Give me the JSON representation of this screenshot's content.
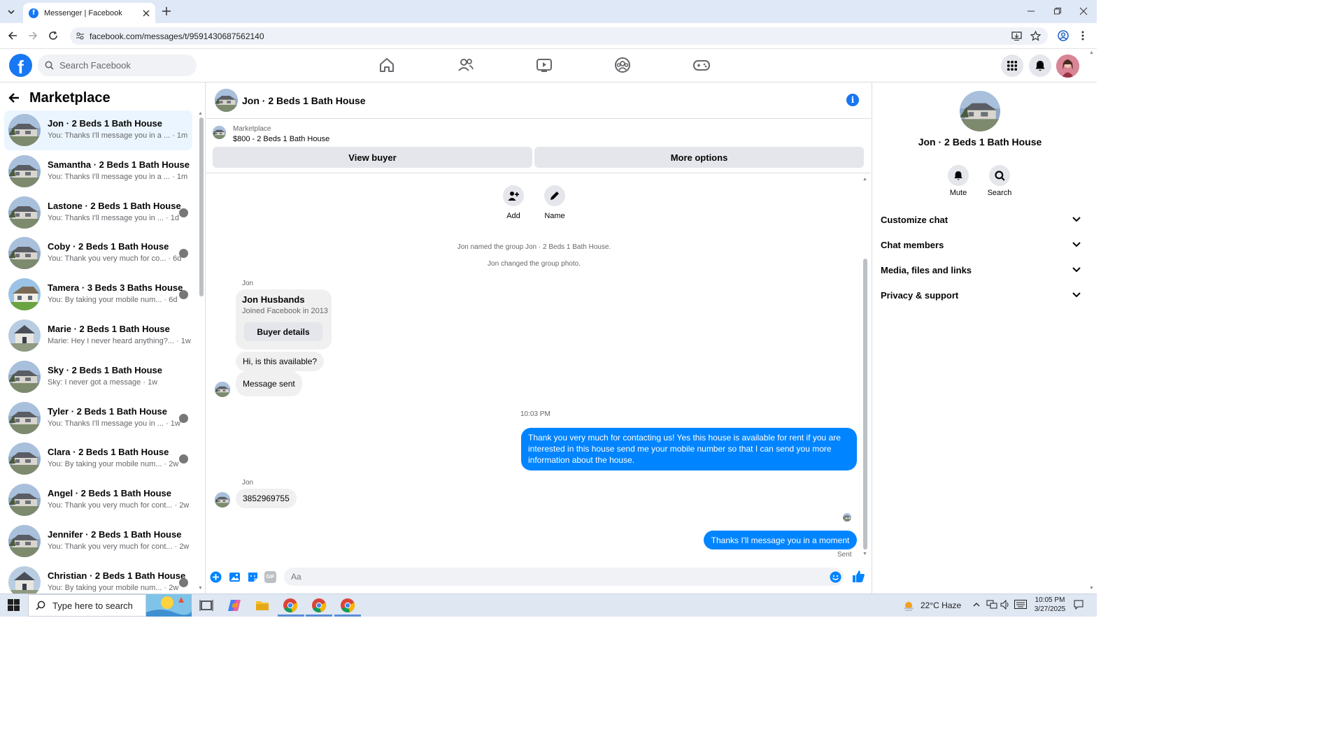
{
  "browser": {
    "tab_title": "Messenger | Facebook",
    "url": "facebook.com/messages/t/9591430687562140"
  },
  "fb": {
    "search_placeholder": "Search Facebook"
  },
  "sidebar": {
    "title": "Marketplace",
    "conversations": [
      {
        "name": "Jon · 2 Beds 1 Bath House",
        "preview": "You: Thanks I'll message you in a ... · 1m",
        "active": true
      },
      {
        "name": "Samantha · 2 Beds 1 Bath House",
        "preview": "You: Thanks I'll message you in a ... · 1m"
      },
      {
        "name": "Lastone · 2 Beds 1 Bath House",
        "preview": "You: Thanks I'll message you in ... · 1d"
      },
      {
        "name": "Coby · 2 Beds 1 Bath House",
        "preview": "You: Thank you very much for co... · 6d"
      },
      {
        "name": "Tamera · 3 Beds 3 Baths House",
        "preview": "You: By taking your mobile num... · 6d"
      },
      {
        "name": "Marie · 2 Beds 1 Bath House",
        "preview": "Marie: Hey I never heard anything?... · 1w"
      },
      {
        "name": "Sky · 2 Beds 1 Bath House",
        "preview": "Sky: I never got a message · 1w"
      },
      {
        "name": "Tyler · 2 Beds 1 Bath House",
        "preview": "You: Thanks I'll message you in ... · 1w"
      },
      {
        "name": "Clara · 2 Beds 1 Bath House",
        "preview": "You: By taking your mobile num... · 2w"
      },
      {
        "name": "Angel · 2 Beds 1 Bath House",
        "preview": "You: Thank you very much for cont... · 2w"
      },
      {
        "name": "Jennifer · 2 Beds 1 Bath House",
        "preview": "You: Thank you very much for cont... · 2w"
      },
      {
        "name": "Christian · 2 Beds 1 Bath House",
        "preview": "You: By taking your mobile num... · 2w"
      }
    ]
  },
  "chat": {
    "title": "Jon · 2 Beds 1 Bath House",
    "marketplace_label": "Marketplace",
    "listing": "$800 - 2 Beds 1 Bath House",
    "view_buyer": "View buyer",
    "more_options": "More options",
    "add_label": "Add",
    "name_label": "Name",
    "system_1": "Jon named the group Jon · 2 Beds 1 Bath House.",
    "system_2": "Jon changed the group photo.",
    "sender_jon": "Jon",
    "card_name": "Jon Husbands",
    "card_sub": "Joined Facebook in 2013",
    "buyer_details": "Buyer details",
    "msg_available": "Hi, is this available?",
    "msg_sent_notice": "Message sent",
    "timestamp": "10:03 PM",
    "msg_out_1": "Thank you very much for contacting us! Yes this house is available for rent if you are interested in this house send me your mobile number so that I can send you more information about the house.",
    "msg_phone": "3852969755",
    "msg_out_2": "Thanks I'll message you in a moment",
    "status_sent": "Sent",
    "composer_placeholder": "Aa"
  },
  "details": {
    "title": "Jon · 2 Beds 1 Bath House",
    "mute": "Mute",
    "search": "Search",
    "sections": [
      "Customize chat",
      "Chat members",
      "Media, files and links",
      "Privacy & support"
    ]
  },
  "taskbar": {
    "search_placeholder": "Type here to search",
    "weather": "22°C  Haze",
    "time": "10:05 PM",
    "date": "3/27/2025"
  },
  "colors": {
    "fb_blue": "#1877f2",
    "messenger_blue": "#0084ff",
    "active_item": "#ebf5ff"
  }
}
